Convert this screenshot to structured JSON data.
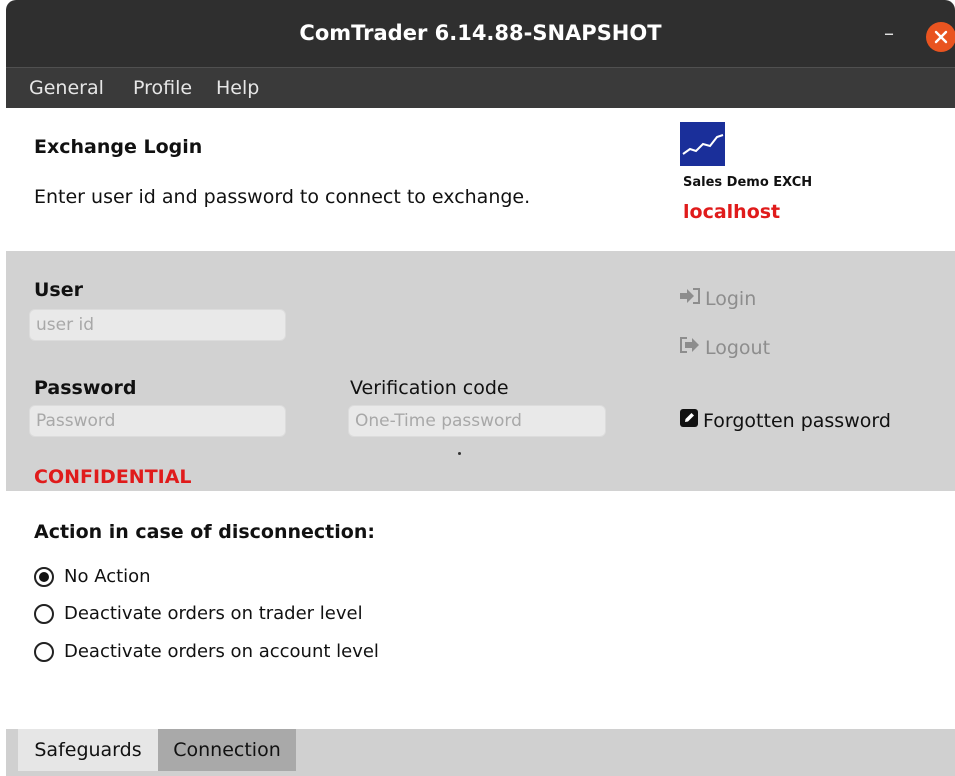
{
  "window": {
    "title": "ComTrader 6.14.88-SNAPSHOT",
    "minimize_glyph": "–"
  },
  "menubar": {
    "items": [
      {
        "label": "General"
      },
      {
        "label": "Profile"
      },
      {
        "label": "Help"
      }
    ]
  },
  "header": {
    "title": "Exchange Login",
    "subtitle": "Enter user id and password to connect to exchange.",
    "exchange_name": "Sales Demo EXCH",
    "host": "localhost"
  },
  "login": {
    "user_label": "User",
    "user_placeholder": "user id",
    "user_value": "",
    "password_label": "Password",
    "password_placeholder": "Password",
    "password_value": "",
    "verification_label": "Verification code",
    "verification_placeholder": "One-Time password",
    "verification_value": "",
    "login_label": "Login",
    "logout_label": "Logout",
    "forgotten_label": "Forgotten password",
    "confidential": "CONFIDENTIAL"
  },
  "disconnection": {
    "title": "Action in case of disconnection:",
    "options": [
      {
        "label": "No Action",
        "checked": true
      },
      {
        "label": "Deactivate orders on trader level",
        "checked": false
      },
      {
        "label": "Deactivate orders on account level",
        "checked": false
      }
    ]
  },
  "tabs": [
    {
      "label": "Safeguards",
      "active": true
    },
    {
      "label": "Connection",
      "active": false
    }
  ],
  "colors": {
    "titlebar": "#2f2f2f",
    "menubar": "#3a3a3a",
    "close_button": "#e95420",
    "alert_red": "#e01b1b",
    "logo_blue": "#1a2f9a",
    "panel_gray": "#d2d2d2"
  },
  "icons": {
    "login": "sign-in-icon",
    "logout": "sign-out-icon",
    "forgotten": "edit-icon",
    "close": "close-icon",
    "logo": "exchange-logo"
  }
}
